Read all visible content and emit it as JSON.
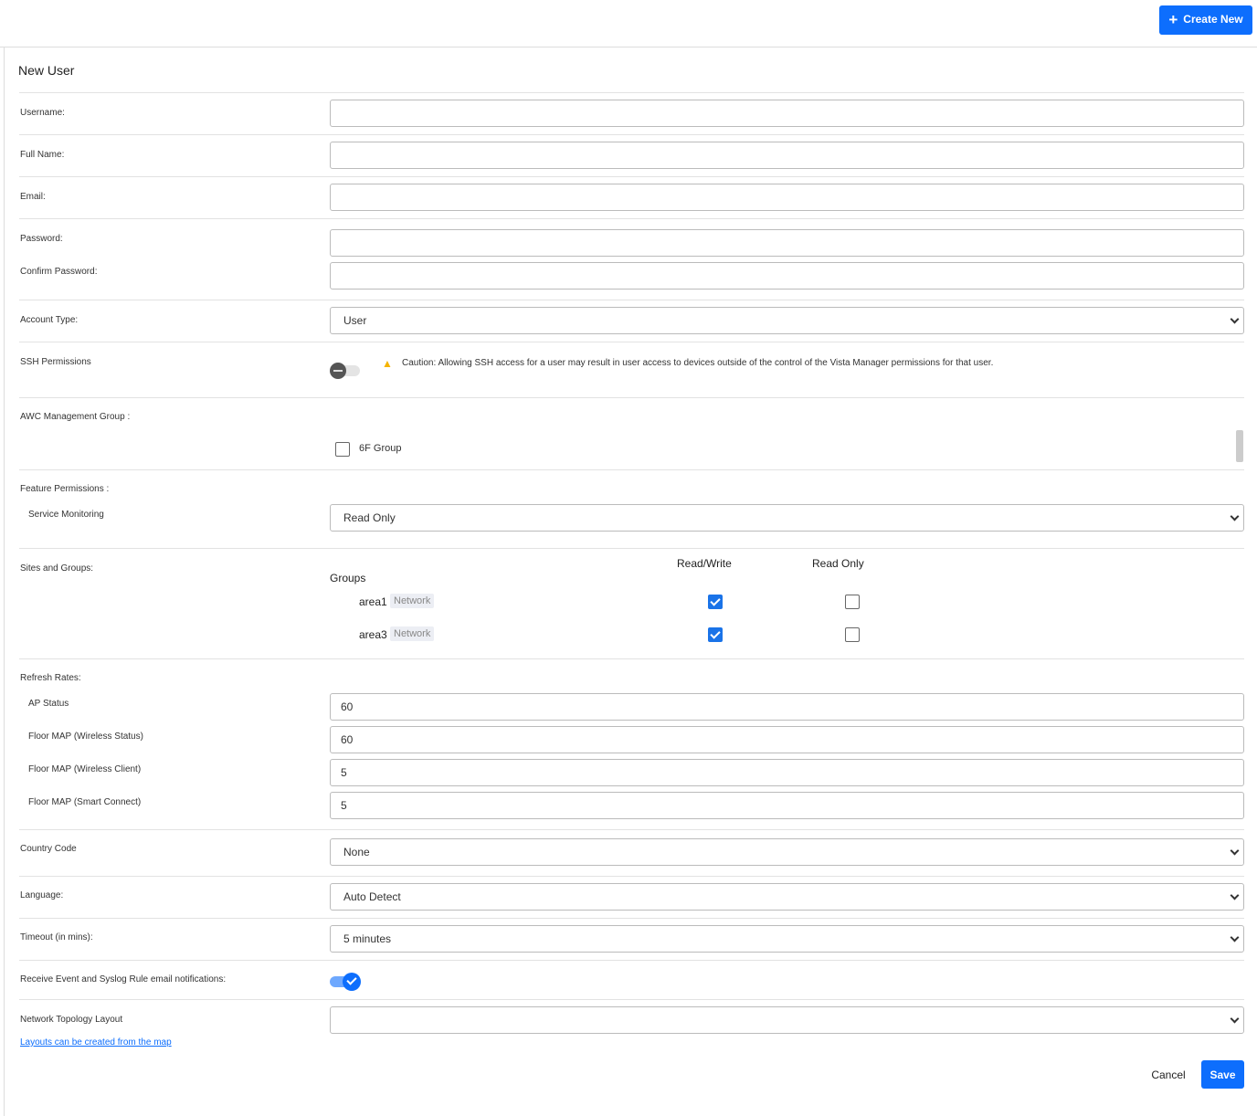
{
  "header": {
    "create_new": "Create New"
  },
  "title": "New User",
  "fields": {
    "username": {
      "label": "Username:",
      "value": ""
    },
    "full_name": {
      "label": "Full Name:",
      "value": ""
    },
    "email": {
      "label": "Email:",
      "value": ""
    },
    "password": {
      "label": "Password:",
      "value": ""
    },
    "confirm_password": {
      "label": "Confirm Password:",
      "value": ""
    },
    "account_type": {
      "label": "Account Type:",
      "value": "User"
    }
  },
  "ssh": {
    "label": "SSH Permissions",
    "enabled": false,
    "caution": "Caution: Allowing SSH access for a user may result in user access to devices outside of the control of the Vista Manager permissions for that user."
  },
  "awc": {
    "label": "AWC Management Group :",
    "groups": [
      {
        "name": "6F Group",
        "checked": false
      }
    ]
  },
  "feature": {
    "label": "Feature Permissions :",
    "service_monitoring": {
      "label": "Service Monitoring",
      "value": "Read Only"
    }
  },
  "sites": {
    "label": "Sites and Groups:",
    "groups_header": "Groups",
    "rw_header": "Read/Write",
    "ro_header": "Read Only",
    "rows": [
      {
        "name": "area1",
        "tag": "Network",
        "rw": true,
        "ro": false
      },
      {
        "name": "area3",
        "tag": "Network",
        "rw": true,
        "ro": false
      }
    ]
  },
  "refresh": {
    "label": "Refresh Rates:",
    "items": [
      {
        "label": "AP Status",
        "value": "60"
      },
      {
        "label": "Floor MAP (Wireless Status)",
        "value": "60"
      },
      {
        "label": "Floor MAP (Wireless Client)",
        "value": "5"
      },
      {
        "label": "Floor MAP (Smart Connect)",
        "value": "5"
      }
    ]
  },
  "country": {
    "label": "Country Code",
    "value": "None"
  },
  "language": {
    "label": "Language:",
    "value": "Auto Detect"
  },
  "timeout": {
    "label": "Timeout (in mins):",
    "value": "5 minutes"
  },
  "notifications": {
    "label": "Receive Event and Syslog Rule email notifications:",
    "enabled": true
  },
  "topology": {
    "label": "Network Topology Layout",
    "value": "",
    "link": "Layouts can be created from the map"
  },
  "actions": {
    "cancel": "Cancel",
    "save": "Save"
  },
  "colors": {
    "primary": "#0d6efd"
  }
}
